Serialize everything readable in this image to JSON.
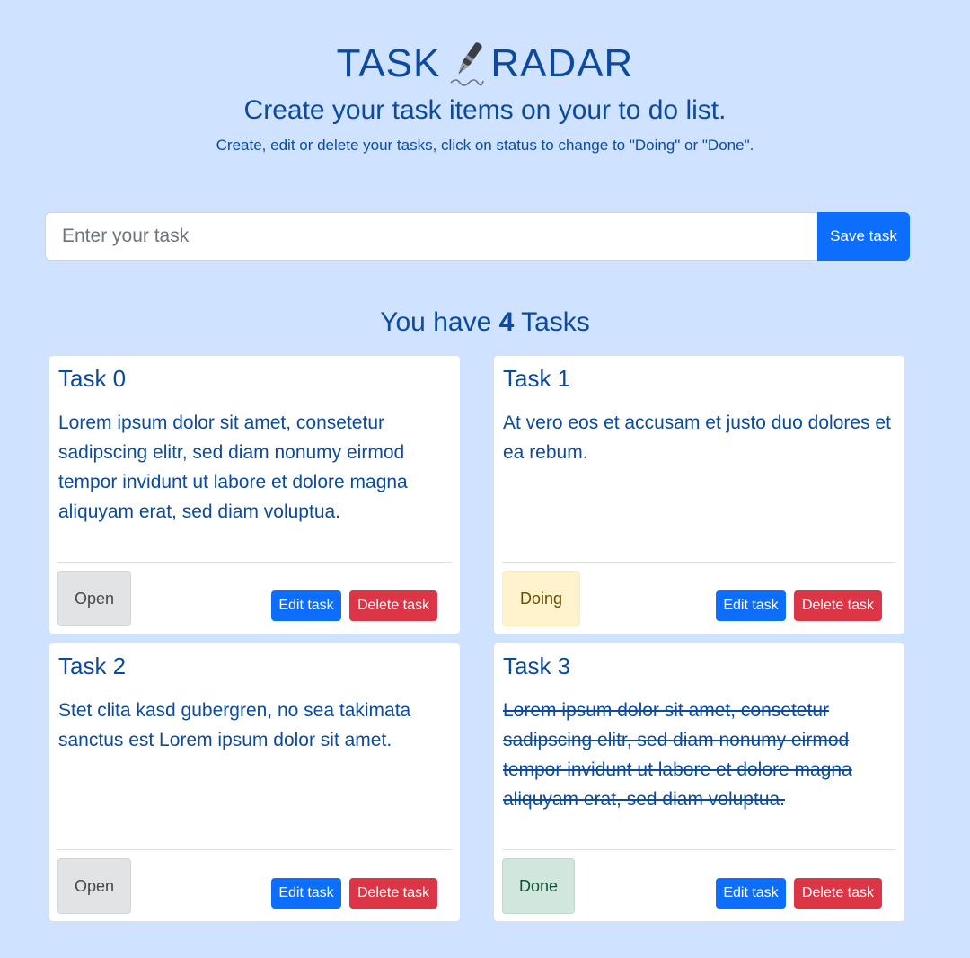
{
  "header": {
    "title_left": "TASK",
    "title_right": "RADAR",
    "logo_icon": "fountain-pen-icon",
    "subtitle": "Create your task items on your to do list.",
    "hint": "Create, edit or delete your tasks, click on status to change to \"Doing\" or \"Done\"."
  },
  "form": {
    "placeholder": "Enter your task",
    "value": "",
    "save_label": "Save task"
  },
  "summary": {
    "prefix": "You have",
    "count": "4",
    "suffix": "Tasks"
  },
  "tasks": [
    {
      "title": "Task 0",
      "text": "Lorem ipsum dolor sit amet, consetetur sadipscing elitr, sed diam nonumy eirmod tempor invidunt ut labore et dolore magna aliquyam erat, sed diam voluptua.",
      "status": "Open",
      "edit_label": "Edit task",
      "delete_label": "Delete task"
    },
    {
      "title": "Task 1",
      "text": "At vero eos et accusam et justo duo dolores et ea rebum.",
      "status": "Doing",
      "edit_label": "Edit task",
      "delete_label": "Delete task"
    },
    {
      "title": "Task 2",
      "text": "Stet clita kasd gubergren, no sea takimata sanctus est Lorem ipsum dolor sit amet.",
      "status": "Open",
      "edit_label": "Edit task",
      "delete_label": "Delete task"
    },
    {
      "title": "Task 3",
      "text": "Lorem ipsum dolor sit amet, consetetur sadipscing elitr, sed diam nonumy eirmod tempor invidunt ut labore et dolore magna aliquyam erat, sed diam voluptua.",
      "status": "Done",
      "edit_label": "Edit task",
      "delete_label": "Delete task"
    }
  ],
  "colors": {
    "background": "#cfe2ff",
    "primary": "#0d6efd",
    "danger": "#dc3545",
    "text": "#0b4a9e",
    "status_open": "#e2e3e5",
    "status_doing": "#fff3cd",
    "status_done": "#d1e7dd"
  }
}
